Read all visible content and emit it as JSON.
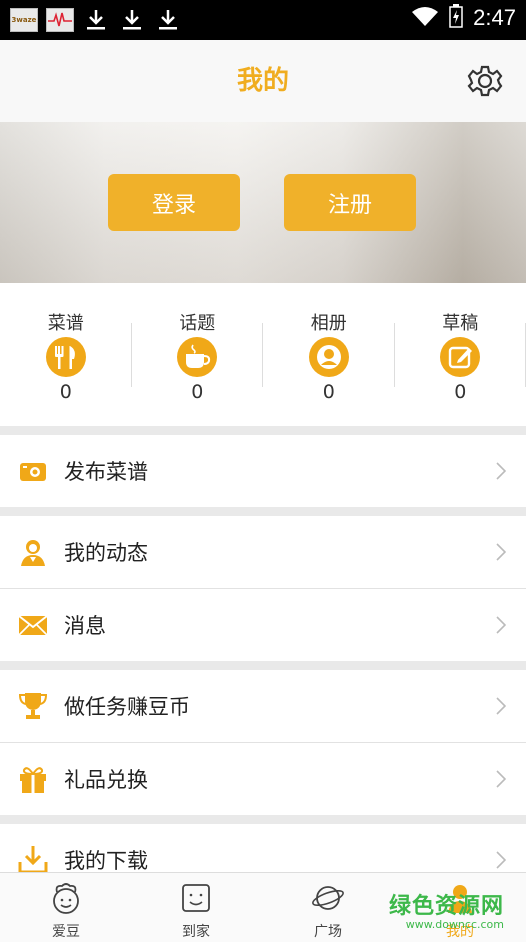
{
  "status_bar": {
    "time": "2:47",
    "app_icon_text": "3waze"
  },
  "header": {
    "title": "我的"
  },
  "banner": {
    "login_label": "登录",
    "register_label": "注册"
  },
  "stats": [
    {
      "label": "菜谱",
      "count": "0",
      "icon": "fork-knife-icon"
    },
    {
      "label": "话题",
      "count": "0",
      "icon": "coffee-cup-icon"
    },
    {
      "label": "相册",
      "count": "0",
      "icon": "person-photo-icon"
    },
    {
      "label": "草稿",
      "count": "0",
      "icon": "edit-icon"
    }
  ],
  "menu": {
    "publish": "发布菜谱",
    "moments": "我的动态",
    "messages": "消息",
    "tasks": "做任务赚豆币",
    "gifts": "礼品兑换",
    "downloads": "我的下载"
  },
  "bottom_nav": [
    {
      "label": "爱豆"
    },
    {
      "label": "到家"
    },
    {
      "label": "广场"
    },
    {
      "label": "我的"
    }
  ],
  "watermark": {
    "main": "绿色资源网",
    "sub": "www.downcc.com"
  },
  "colors": {
    "accent": "#f0a818",
    "watermark": "#3db84a"
  }
}
